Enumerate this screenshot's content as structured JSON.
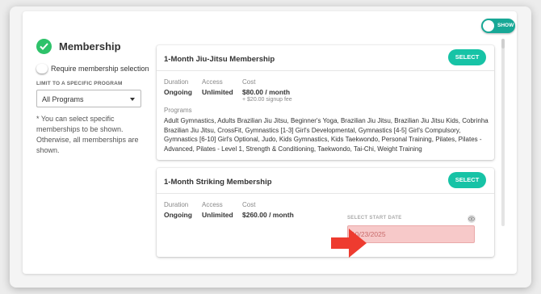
{
  "section": {
    "title": "Membership",
    "require_label": "Require membership selection",
    "limit_label": "LIMIT TO A SPECIFIC PROGRAM",
    "program_value": "All Programs",
    "note": "* You can select specific memberships to be shown. Otherwise, all memberships are shown."
  },
  "cards": [
    {
      "title": "1-Month Jiu-Jitsu Membership",
      "select_label": "SELECT",
      "duration_label": "Duration",
      "duration": "Ongoing",
      "access_label": "Access",
      "access": "Unlimited",
      "cost_label": "Cost",
      "cost": "$80.00 / month",
      "fee": "+ $20.00 signup fee",
      "programs_label": "Programs",
      "programs": "Adult Gymnastics, Adults Brazilian Jiu Jitsu, Beginner's Yoga, Brazilian Jiu Jitsu, Brazilian Jiu Jitsu Kids, Cobrinha Brazilian Jiu Jitsu, CrossFit, Gymnastics [1-3] Girl's Developmental, Gymnastics [4-5] Girl's Compulsory, Gymnastics [6-10] Girl's Optional, Judo, Kids Gymnastics, Kids Taekwondo, Personal Training, Pilates, Pilates - Advanced, Pilates - Level 1, Strength & Conditioning, Taekwondo, Tai-Chi, Weight Training"
    },
    {
      "title": "1-Month Striking Membership",
      "select_label": "SELECT",
      "duration_label": "Duration",
      "duration": "Ongoing",
      "access_label": "Access",
      "access": "Unlimited",
      "cost_label": "Cost",
      "cost": "$260.00 / month"
    }
  ],
  "date": {
    "label": "SELECT START DATE",
    "value": "10/23/2025"
  },
  "toggle": {
    "label": "SHOW"
  },
  "colors": {
    "accent": "#17c3a6",
    "check": "#2ec26a",
    "arrow": "#ee3b2f",
    "date_bg": "#f7c9c9"
  }
}
